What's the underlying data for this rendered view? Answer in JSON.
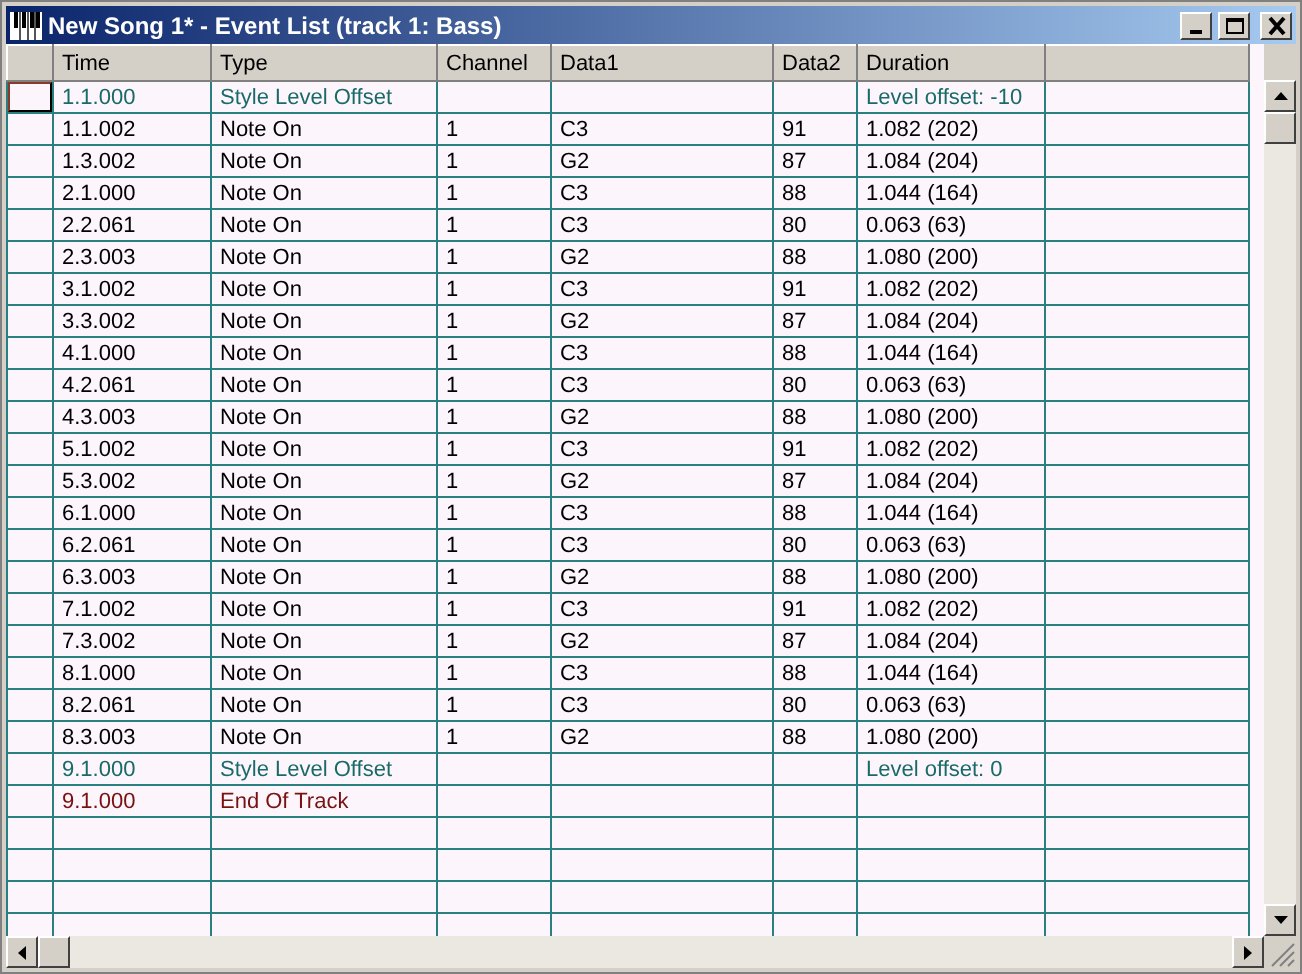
{
  "window": {
    "title": "New Song 1* - Event List (track 1: Bass)",
    "buttons": [
      {
        "kind": "minimize"
      },
      {
        "kind": "maximize"
      },
      {
        "kind": "close"
      }
    ]
  },
  "table": {
    "columns": [
      "Time",
      "Type",
      "Channel",
      "Data1",
      "Data2",
      "Duration"
    ],
    "rows": [
      {
        "kind": "style",
        "selected": true,
        "cells": [
          "1.1.000",
          "Style Level Offset",
          "",
          "",
          "",
          "Level offset: -10"
        ]
      },
      {
        "kind": "note",
        "selected": false,
        "cells": [
          "1.1.002",
          "Note On",
          "1",
          "C3",
          "91",
          "1.082 (202)"
        ]
      },
      {
        "kind": "note",
        "selected": false,
        "cells": [
          "1.3.002",
          "Note On",
          "1",
          "G2",
          "87",
          "1.084 (204)"
        ]
      },
      {
        "kind": "note",
        "selected": false,
        "cells": [
          "2.1.000",
          "Note On",
          "1",
          "C3",
          "88",
          "1.044 (164)"
        ]
      },
      {
        "kind": "note",
        "selected": false,
        "cells": [
          "2.2.061",
          "Note On",
          "1",
          "C3",
          "80",
          "0.063 (63)"
        ]
      },
      {
        "kind": "note",
        "selected": false,
        "cells": [
          "2.3.003",
          "Note On",
          "1",
          "G2",
          "88",
          "1.080 (200)"
        ]
      },
      {
        "kind": "note",
        "selected": false,
        "cells": [
          "3.1.002",
          "Note On",
          "1",
          "C3",
          "91",
          "1.082 (202)"
        ]
      },
      {
        "kind": "note",
        "selected": false,
        "cells": [
          "3.3.002",
          "Note On",
          "1",
          "G2",
          "87",
          "1.084 (204)"
        ]
      },
      {
        "kind": "note",
        "selected": false,
        "cells": [
          "4.1.000",
          "Note On",
          "1",
          "C3",
          "88",
          "1.044 (164)"
        ]
      },
      {
        "kind": "note",
        "selected": false,
        "cells": [
          "4.2.061",
          "Note On",
          "1",
          "C3",
          "80",
          "0.063 (63)"
        ]
      },
      {
        "kind": "note",
        "selected": false,
        "cells": [
          "4.3.003",
          "Note On",
          "1",
          "G2",
          "88",
          "1.080 (200)"
        ]
      },
      {
        "kind": "note",
        "selected": false,
        "cells": [
          "5.1.002",
          "Note On",
          "1",
          "C3",
          "91",
          "1.082 (202)"
        ]
      },
      {
        "kind": "note",
        "selected": false,
        "cells": [
          "5.3.002",
          "Note On",
          "1",
          "G2",
          "87",
          "1.084 (204)"
        ]
      },
      {
        "kind": "note",
        "selected": false,
        "cells": [
          "6.1.000",
          "Note On",
          "1",
          "C3",
          "88",
          "1.044 (164)"
        ]
      },
      {
        "kind": "note",
        "selected": false,
        "cells": [
          "6.2.061",
          "Note On",
          "1",
          "C3",
          "80",
          "0.063 (63)"
        ]
      },
      {
        "kind": "note",
        "selected": false,
        "cells": [
          "6.3.003",
          "Note On",
          "1",
          "G2",
          "88",
          "1.080 (200)"
        ]
      },
      {
        "kind": "note",
        "selected": false,
        "cells": [
          "7.1.002",
          "Note On",
          "1",
          "C3",
          "91",
          "1.082 (202)"
        ]
      },
      {
        "kind": "note",
        "selected": false,
        "cells": [
          "7.3.002",
          "Note On",
          "1",
          "G2",
          "87",
          "1.084 (204)"
        ]
      },
      {
        "kind": "note",
        "selected": false,
        "cells": [
          "8.1.000",
          "Note On",
          "1",
          "C3",
          "88",
          "1.044 (164)"
        ]
      },
      {
        "kind": "note",
        "selected": false,
        "cells": [
          "8.2.061",
          "Note On",
          "1",
          "C3",
          "80",
          "0.063 (63)"
        ]
      },
      {
        "kind": "note",
        "selected": false,
        "cells": [
          "8.3.003",
          "Note On",
          "1",
          "G2",
          "88",
          "1.080 (200)"
        ]
      },
      {
        "kind": "style",
        "selected": false,
        "cells": [
          "9.1.000",
          "Style Level Offset",
          "",
          "",
          "",
          "Level offset: 0"
        ]
      },
      {
        "kind": "end",
        "selected": false,
        "cells": [
          "9.1.000",
          "End Of Track",
          "",
          "",
          "",
          ""
        ]
      }
    ]
  }
}
